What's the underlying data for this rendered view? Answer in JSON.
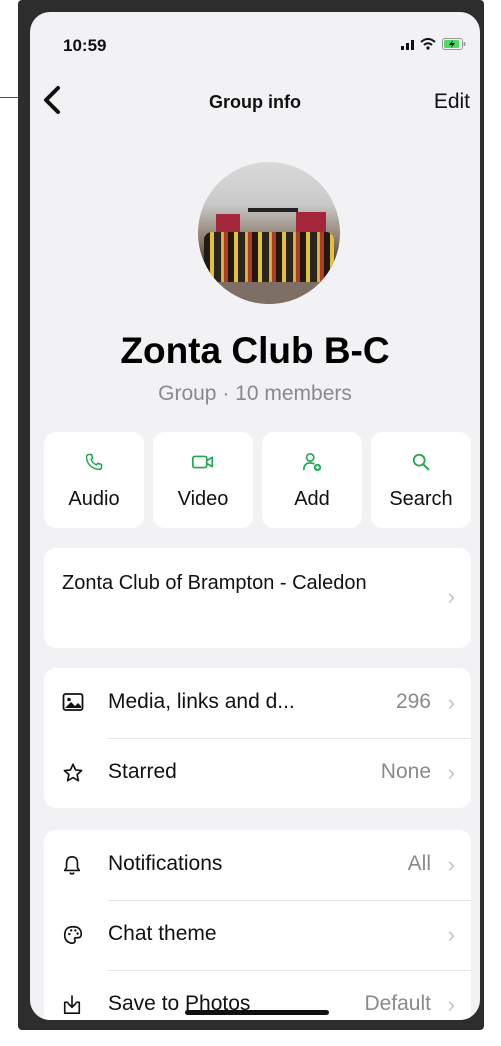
{
  "status_bar": {
    "time": "10:59"
  },
  "nav": {
    "title": "Group info",
    "edit_label": "Edit"
  },
  "group": {
    "name": "Zonta Club B-C",
    "subtitle": "Group · 10 members"
  },
  "actions": [
    {
      "label": "Audio",
      "icon": "phone-icon"
    },
    {
      "label": "Video",
      "icon": "video-icon"
    },
    {
      "label": "Add",
      "icon": "add-person-icon"
    },
    {
      "label": "Search",
      "icon": "search-icon"
    }
  ],
  "description": {
    "text": "Zonta Club of Brampton - Caledon"
  },
  "media_section": {
    "media": {
      "label": "Media, links and d...",
      "value": "296"
    },
    "starred": {
      "label": "Starred",
      "value": "None"
    }
  },
  "settings_section": {
    "notifications": {
      "label": "Notifications",
      "value": "All"
    },
    "chat_theme": {
      "label": "Chat theme",
      "value": ""
    },
    "save_to_photos": {
      "label": "Save to Photos",
      "value": "Default"
    }
  },
  "colors": {
    "accent": "#1da851",
    "background": "#f2f2f5",
    "secondary_text": "#8a8a8e"
  }
}
